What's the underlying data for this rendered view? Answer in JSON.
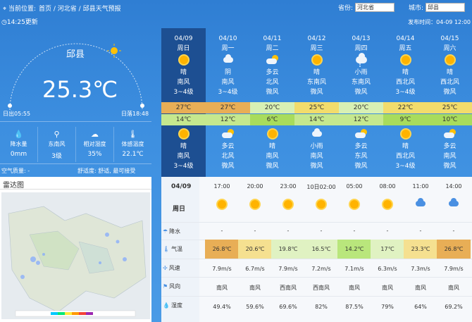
{
  "header": {
    "location_prefix": "当前位置:",
    "breadcrumb": [
      "首页",
      "河北省",
      "邱县天气预报"
    ],
    "province_label": "省份:",
    "province_value": "河北省",
    "city_label": "城市:",
    "city_value": "邱县",
    "updated": "14:25更新",
    "published": "发布时间：04-09 12:00"
  },
  "current": {
    "city": "邱县",
    "temperature": "25.3℃",
    "sunrise": "日出05:55",
    "sunset": "日落18:48",
    "stats": [
      {
        "icon": "raindrop-icon",
        "label": "降水量",
        "value": "0mm"
      },
      {
        "icon": "wind-turbine-icon",
        "label": "东南风",
        "value": "3级"
      },
      {
        "icon": "humidity-icon",
        "label": "相对湿度",
        "value": "35%"
      },
      {
        "icon": "thermometer-icon",
        "label": "体感温度",
        "value": "22.1℃"
      }
    ],
    "air_quality": "空气质量: -",
    "comfort": "舒适度: 舒适, 最可接受"
  },
  "radar": {
    "title": "雷达图"
  },
  "days": [
    {
      "date": "04/09",
      "weekday": "周日",
      "day_icon": "sun",
      "day_weather": "晴",
      "day_wind_dir": "南风",
      "day_wind_lvl": "3~4级",
      "high": "27℃",
      "high_color": "#e8ae56",
      "low": "14℃",
      "low_color": "#c5e88e",
      "night_icon": "sun",
      "night_weather": "晴",
      "night_wind_dir": "南风",
      "night_wind_lvl": "3~4级"
    },
    {
      "date": "04/10",
      "weekday": "周一",
      "day_icon": "cloud",
      "day_weather": "阴",
      "day_wind_dir": "南风",
      "day_wind_lvl": "3~4级",
      "high": "27℃",
      "high_color": "#e8ae56",
      "low": "12℃",
      "low_color": "#c5e88e",
      "night_icon": "pcloud",
      "night_weather": "多云",
      "night_wind_dir": "北风",
      "night_wind_lvl": "微风"
    },
    {
      "date": "04/11",
      "weekday": "周二",
      "day_icon": "pcloud",
      "day_weather": "多云",
      "day_wind_dir": "北风",
      "day_wind_lvl": "微风",
      "high": "20℃",
      "high_color": "#d8f0b4",
      "low": "6℃",
      "low_color": "#a8dc5c",
      "night_icon": "sun",
      "night_weather": "晴",
      "night_wind_dir": "南风",
      "night_wind_lvl": "微风"
    },
    {
      "date": "04/12",
      "weekday": "周三",
      "day_icon": "sun",
      "day_weather": "晴",
      "day_wind_dir": "东南风",
      "day_wind_lvl": "微风",
      "high": "25℃",
      "high_color": "#f2dc6c",
      "low": "14℃",
      "low_color": "#c5e88e",
      "night_icon": "cloud",
      "night_weather": "小雨",
      "night_wind_dir": "南风",
      "night_wind_lvl": "微风"
    },
    {
      "date": "04/13",
      "weekday": "周四",
      "day_icon": "rain",
      "day_weather": "小雨",
      "day_wind_dir": "东南风",
      "day_wind_lvl": "微风",
      "high": "20℃",
      "high_color": "#d8f0b4",
      "low": "12℃",
      "low_color": "#c5e88e",
      "night_icon": "pcloud",
      "night_weather": "多云",
      "night_wind_dir": "东风",
      "night_wind_lvl": "微风"
    },
    {
      "date": "04/14",
      "weekday": "周五",
      "day_icon": "sun",
      "day_weather": "晴",
      "day_wind_dir": "西北风",
      "day_wind_lvl": "3~4级",
      "high": "22℃",
      "high_color": "#f2dc6c",
      "low": "9℃",
      "low_color": "#a8dc5c",
      "night_icon": "sun",
      "night_weather": "晴",
      "night_wind_dir": "西北风",
      "night_wind_lvl": "3~4级"
    },
    {
      "date": "04/15",
      "weekday": "周六",
      "day_icon": "sun",
      "day_weather": "晴",
      "day_wind_dir": "西北风",
      "day_wind_lvl": "微风",
      "high": "25℃",
      "high_color": "#f2dc6c",
      "low": "10℃",
      "low_color": "#a8dc5c",
      "night_icon": "pcloud",
      "night_weather": "多云",
      "night_wind_dir": "南风",
      "night_wind_lvl": "微风"
    }
  ],
  "hourly": {
    "date_label": "04/09",
    "weekday_label": "周日",
    "row_labels": {
      "precip": "降水",
      "temp": "气温",
      "wind_speed": "风速",
      "wind_dir": "风向",
      "humidity": "湿度"
    },
    "hours": [
      {
        "time": "17:00",
        "icon": "sun",
        "precip": "-",
        "temp": "26.8℃",
        "temp_color": "#e8ae56",
        "wind_speed": "7.9m/s",
        "wind_dir": "南风",
        "humidity": "49.4%"
      },
      {
        "time": "20:00",
        "icon": "sun",
        "precip": "-",
        "temp": "20.6℃",
        "temp_color": "#f5e090",
        "wind_speed": "6.7m/s",
        "wind_dir": "南风",
        "humidity": "59.6%"
      },
      {
        "time": "23:00",
        "icon": "sun",
        "precip": "-",
        "temp": "19.8℃",
        "temp_color": "#e0f2c2",
        "wind_speed": "7.9m/s",
        "wind_dir": "西南风",
        "humidity": "69.6%"
      },
      {
        "time": "10日02:00",
        "icon": "sun",
        "precip": "-",
        "temp": "16.5℃",
        "temp_color": "#e0f2c2",
        "wind_speed": "7.2m/s",
        "wind_dir": "西南风",
        "humidity": "82%"
      },
      {
        "time": "05:00",
        "icon": "sun",
        "precip": "-",
        "temp": "14.2℃",
        "temp_color": "#b9e67c",
        "wind_speed": "7.1m/s",
        "wind_dir": "南风",
        "humidity": "87.5%"
      },
      {
        "time": "08:00",
        "icon": "sun",
        "precip": "-",
        "temp": "17℃",
        "temp_color": "#e0f2c2",
        "wind_speed": "6.3m/s",
        "wind_dir": "南风",
        "humidity": "79%"
      },
      {
        "time": "11:00",
        "icon": "cloud",
        "precip": "-",
        "temp": "23.3℃",
        "temp_color": "#f5e090",
        "wind_speed": "7.3m/s",
        "wind_dir": "南风",
        "humidity": "64%"
      },
      {
        "time": "14:00",
        "icon": "cloud",
        "precip": "-",
        "temp": "26.8℃",
        "temp_color": "#e8ae56",
        "wind_speed": "7.9m/s",
        "wind_dir": "南风",
        "humidity": "69.2%"
      }
    ]
  }
}
